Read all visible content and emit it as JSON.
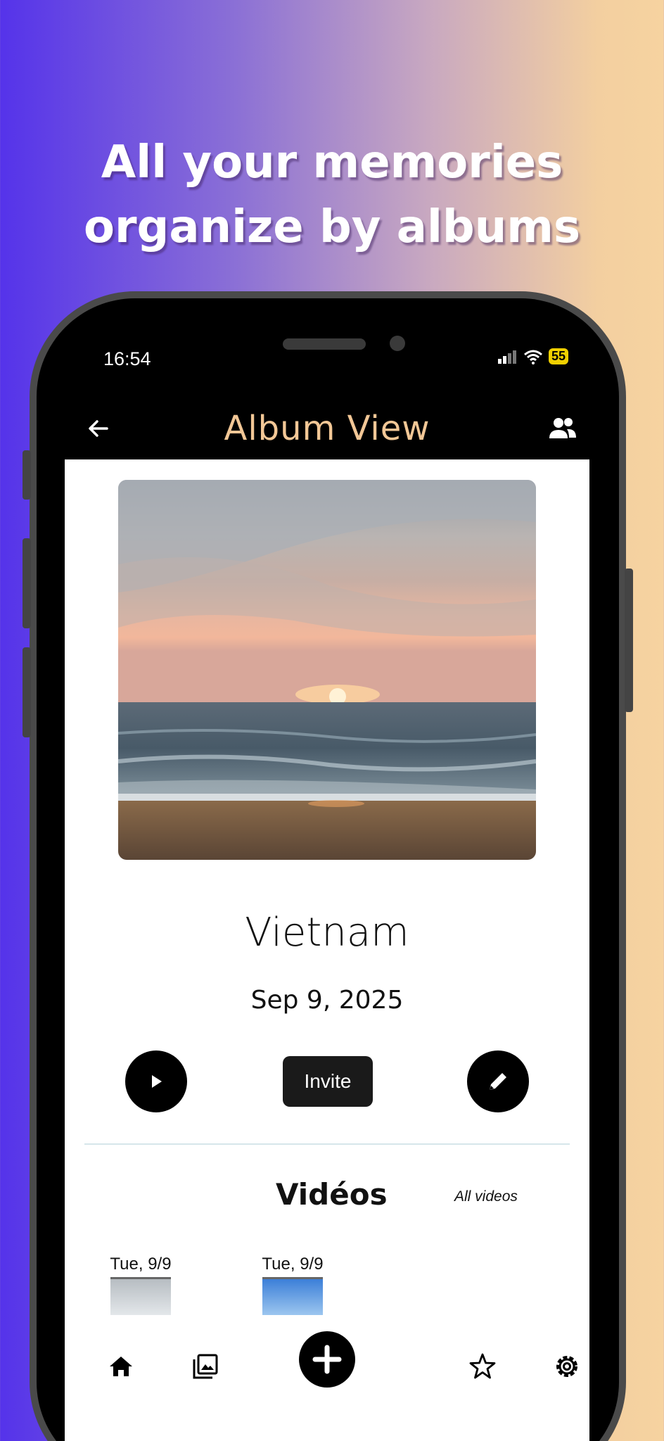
{
  "headline": {
    "line1": "All your memories",
    "line2": "organize by albums"
  },
  "status_bar": {
    "time": "16:54",
    "battery": "55"
  },
  "app_bar": {
    "title": "Album View",
    "back_icon": "arrow-left-icon",
    "share_icon": "people-icon"
  },
  "album": {
    "name": "Vietnam",
    "date": "Sep 9, 2025",
    "cover_description_icon": "sunset-beach-photo"
  },
  "actions": {
    "play_icon": "play-icon",
    "invite_label": "Invite",
    "edit_icon": "pencil-icon"
  },
  "videos_section": {
    "title": "Vidéos",
    "all_link": "All videos",
    "items": [
      {
        "date": "Tue, 9/9"
      },
      {
        "date": "Tue, 9/9"
      }
    ]
  },
  "bottom_nav": {
    "items": [
      "home-icon",
      "gallery-icon",
      "add-icon",
      "star-icon",
      "settings-icon"
    ]
  },
  "colors": {
    "accent_title": "#f2c796",
    "gradient_start": "#5533ea",
    "gradient_end": "#f6d3a0"
  }
}
